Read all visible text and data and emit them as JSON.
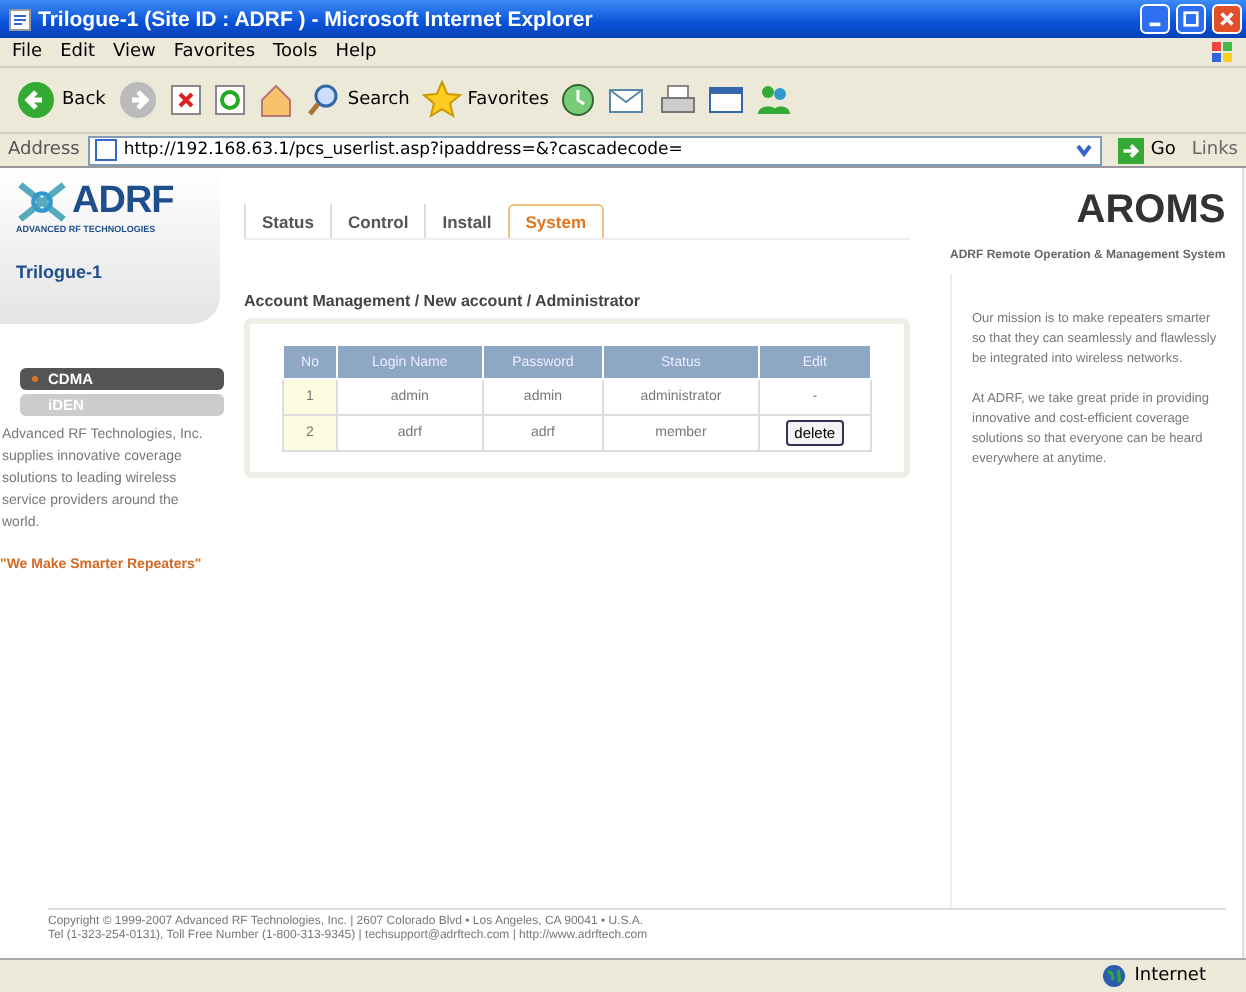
{
  "window": {
    "title": "Trilogue-1 (Site ID : ADRF ) - Microsoft Internet Explorer"
  },
  "menu": [
    "File",
    "Edit",
    "View",
    "Favorites",
    "Tools",
    "Help"
  ],
  "toolbar": [
    {
      "kind": "back",
      "label": "Back"
    },
    {
      "kind": "forward"
    },
    {
      "kind": "stop"
    },
    {
      "kind": "refresh"
    },
    {
      "kind": "home"
    },
    {
      "kind": "search",
      "label": "Search"
    },
    {
      "kind": "favorites",
      "label": "Favorites"
    },
    {
      "kind": "history"
    },
    {
      "kind": "mail"
    },
    {
      "kind": "print"
    },
    {
      "kind": "edit"
    },
    {
      "kind": "messenger"
    }
  ],
  "address": {
    "label": "Address",
    "value": "http://192.168.63.1/pcs_userlist.asp?ipaddress=&?cascadecode=",
    "go": "Go",
    "links": "Links"
  },
  "logo": {
    "name": "ADRF",
    "tagline": "ADVANCED RF TECHNOLOGIES"
  },
  "site_name": "Trilogue-1",
  "tabs": [
    {
      "label": "Status",
      "selected": false
    },
    {
      "label": "Control",
      "selected": false
    },
    {
      "label": "Install",
      "selected": false
    },
    {
      "label": "System",
      "selected": true
    }
  ],
  "brand": {
    "title": "AROMS",
    "subtitle": "ADRF Remote Operation & Management System"
  },
  "breadcrumb": "Account Management / New account / Administrator",
  "table": {
    "columns": [
      "No",
      "Login Name",
      "Password",
      "Status",
      "Edit"
    ],
    "rows": [
      {
        "cells": [
          "1",
          "admin",
          "admin",
          "administrator"
        ],
        "edit": {
          "kind": "text",
          "label": "-"
        }
      },
      {
        "cells": [
          "2",
          "adrf",
          "adrf",
          "member"
        ],
        "edit": {
          "kind": "button",
          "label": "delete"
        }
      }
    ]
  },
  "technologies": [
    {
      "label": "CDMA",
      "selected": true
    },
    {
      "label": "iDEN",
      "selected": false
    }
  ],
  "about": "Advanced RF Technologies, Inc. supplies innovative coverage solutions to leading wireless service providers around the world.",
  "slogan": "\"We Make Smarter Repeaters\"",
  "mission": [
    "Our mission is to make repeaters smarter so that they can seamlessly and flawlessly be integrated into wireless networks.",
    "At ADRF, we take great pride in providing innovative and cost-efficient coverage solutions so that everyone can be heard everywhere at anytime."
  ],
  "footer": [
    "Copyright © 1999-2007 Advanced RF Technologies, Inc. | 2607 Colorado Blvd • Los Angeles, CA 90041 • U.S.A.",
    "Tel (1-323-254-0131), Toll Free Number (1-800-313-9345) | techsupport@adrftech.com | http://www.adrftech.com"
  ],
  "status_bar": {
    "zone": "Internet"
  }
}
